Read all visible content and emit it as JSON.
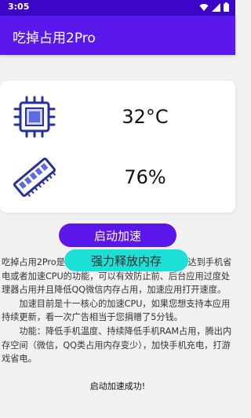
{
  "status_bar": {
    "time": "3:05"
  },
  "app_bar": {
    "title": "吃掉占用2Pro"
  },
  "metrics": {
    "cpu_temp": "32°C",
    "memory_usage": "76%"
  },
  "buttons": {
    "boost_label": "启动加速",
    "release_memory_label": "强力释放内存"
  },
  "description": {
    "paragraph_1": "吃掉占用2Pro是一款通过占用处理器运行空间来达到手机省电或者加速CPU的功能，可以有效防止前、后台应用过度处理器占用并且降低QQ微信内存占用，加速应用打开速度。",
    "paragraph_2": "加速目前是十一核心的加速CPU，如果您想支持本应用持续更新，看一次广告相当于您捐赠了5分钱。",
    "paragraph_3": "功能：降低手机温度、持续降低手机RAM占用，腾出内存空间（微信，QQ类占用内存变少），加快手机充电，打游戏省电。"
  },
  "status_message": "启动加速成功!",
  "colors": {
    "primary": "#5b18ec",
    "status_bar": "#3b06c6",
    "accent_teal": "#1ce0d6",
    "icon_blue": "#26309a",
    "icon_fill": "#5d6ae0"
  }
}
